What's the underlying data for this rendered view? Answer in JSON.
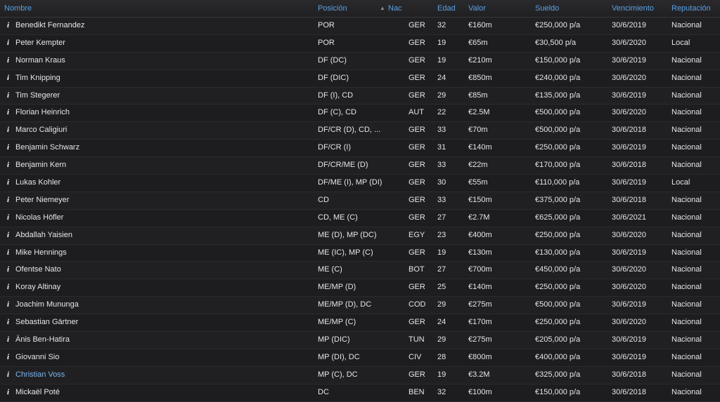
{
  "headers": {
    "name": "Nombre",
    "position": "Posición",
    "nationality": "Nac",
    "age": "Edad",
    "value": "Valor",
    "salary": "Sueldo",
    "expiry": "Vencimiento",
    "reputation": "Reputación"
  },
  "info_glyph": "i",
  "colors": {
    "header_text": "#5aa0e6",
    "link_text": "#7fb3ea",
    "background": "#1b1b1d"
  },
  "rows": [
    {
      "name": "Benedikt Fernandez",
      "position": "POR",
      "flag": "ger-flag-icon",
      "nat": "GER",
      "age": "32",
      "value": "€160m",
      "salary": "€250,000 p/a",
      "expiry": "30/6/2019",
      "reputation": "Nacional"
    },
    {
      "name": "Peter Kempter",
      "position": "POR",
      "flag": "ger-flag-icon",
      "nat": "GER",
      "age": "19",
      "value": "€65m",
      "salary": "€30,500 p/a",
      "expiry": "30/6/2020",
      "reputation": "Local"
    },
    {
      "name": "Norman Kraus",
      "position": "DF (DC)",
      "flag": "ger-flag-icon",
      "nat": "GER",
      "age": "19",
      "value": "€210m",
      "salary": "€150,000 p/a",
      "expiry": "30/6/2019",
      "reputation": "Nacional"
    },
    {
      "name": "Tim Knipping",
      "position": "DF (DIC)",
      "flag": "ger-flag-icon",
      "nat": "GER",
      "age": "24",
      "value": "€850m",
      "salary": "€240,000 p/a",
      "expiry": "30/6/2020",
      "reputation": "Nacional"
    },
    {
      "name": "Tim Stegerer",
      "position": "DF (I), CD",
      "flag": "ger-flag-icon",
      "nat": "GER",
      "age": "29",
      "value": "€85m",
      "salary": "€135,000 p/a",
      "expiry": "30/6/2019",
      "reputation": "Nacional"
    },
    {
      "name": "Florian Heinrich",
      "position": "DF (C), CD",
      "flag": "aut-flag-icon",
      "nat": "AUT",
      "age": "22",
      "value": "€2.5M",
      "salary": "€500,000 p/a",
      "expiry": "30/6/2020",
      "reputation": "Nacional"
    },
    {
      "name": "Marco Caligiuri",
      "position": "DF/CR (D), CD, ...",
      "flag": "ger-flag-icon",
      "nat": "GER",
      "age": "33",
      "value": "€70m",
      "salary": "€500,000 p/a",
      "expiry": "30/6/2018",
      "reputation": "Nacional"
    },
    {
      "name": "Benjamin Schwarz",
      "position": "DF/CR (I)",
      "flag": "ger-flag-icon",
      "nat": "GER",
      "age": "31",
      "value": "€140m",
      "salary": "€250,000 p/a",
      "expiry": "30/6/2019",
      "reputation": "Nacional"
    },
    {
      "name": "Benjamin Kern",
      "position": "DF/CR/ME (D)",
      "flag": "ger-flag-icon",
      "nat": "GER",
      "age": "33",
      "value": "€22m",
      "salary": "€170,000 p/a",
      "expiry": "30/6/2018",
      "reputation": "Nacional"
    },
    {
      "name": "Lukas Kohler",
      "position": "DF/ME (I), MP (DI)",
      "flag": "ger-flag-icon",
      "nat": "GER",
      "age": "30",
      "value": "€55m",
      "salary": "€110,000 p/a",
      "expiry": "30/6/2019",
      "reputation": "Local"
    },
    {
      "name": "Peter Niemeyer",
      "position": "CD",
      "flag": "ger-flag-icon",
      "nat": "GER",
      "age": "33",
      "value": "€150m",
      "salary": "€375,000 p/a",
      "expiry": "30/6/2018",
      "reputation": "Nacional"
    },
    {
      "name": "Nicolas Höfler",
      "position": "CD, ME (C)",
      "flag": "ger-flag-icon",
      "nat": "GER",
      "age": "27",
      "value": "€2.7M",
      "salary": "€625,000 p/a",
      "expiry": "30/6/2021",
      "reputation": "Nacional"
    },
    {
      "name": "Abdallah Yaisien",
      "position": "ME (D), MP (DC)",
      "flag": "egy-flag-icon",
      "nat": "EGY",
      "age": "23",
      "value": "€400m",
      "salary": "€250,000 p/a",
      "expiry": "30/6/2020",
      "reputation": "Nacional"
    },
    {
      "name": "Mike Hennings",
      "position": "ME (IC), MP (C)",
      "flag": "ger-flag-icon",
      "nat": "GER",
      "age": "19",
      "value": "€130m",
      "salary": "€130,000 p/a",
      "expiry": "30/6/2019",
      "reputation": "Nacional"
    },
    {
      "name": "Ofentse Nato",
      "position": "ME (C)",
      "flag": "bot-flag-icon",
      "nat": "BOT",
      "age": "27",
      "value": "€700m",
      "salary": "€450,000 p/a",
      "expiry": "30/6/2020",
      "reputation": "Nacional"
    },
    {
      "name": "Koray Altinay",
      "position": "ME/MP (D)",
      "flag": "ger-flag-icon",
      "nat": "GER",
      "age": "25",
      "value": "€140m",
      "salary": "€250,000 p/a",
      "expiry": "30/6/2020",
      "reputation": "Nacional"
    },
    {
      "name": "Joachim Mununga",
      "position": "ME/MP (D), DC",
      "flag": "cod-flag-icon",
      "nat": "COD",
      "age": "29",
      "value": "€275m",
      "salary": "€500,000 p/a",
      "expiry": "30/6/2019",
      "reputation": "Nacional"
    },
    {
      "name": "Sebastian Gärtner",
      "position": "ME/MP (C)",
      "flag": "ger-flag-icon",
      "nat": "GER",
      "age": "24",
      "value": "€170m",
      "salary": "€250,000 p/a",
      "expiry": "30/6/2020",
      "reputation": "Nacional"
    },
    {
      "name": "Änis Ben-Hatira",
      "position": "MP (DIC)",
      "flag": "tun-flag-icon",
      "nat": "TUN",
      "age": "29",
      "value": "€275m",
      "salary": "€205,000 p/a",
      "expiry": "30/6/2019",
      "reputation": "Nacional"
    },
    {
      "name": "Giovanni Sio",
      "position": "MP (DI), DC",
      "flag": "civ-flag-icon",
      "nat": "CIV",
      "age": "28",
      "value": "€800m",
      "salary": "€400,000 p/a",
      "expiry": "30/6/2019",
      "reputation": "Nacional"
    },
    {
      "name": "Christian Voss",
      "position": "MP (C), DC",
      "flag": "ger-flag-icon",
      "nat": "GER",
      "age": "19",
      "value": "€3.2M",
      "salary": "€325,000 p/a",
      "expiry": "30/6/2018",
      "reputation": "Nacional",
      "link": true
    },
    {
      "name": "Mickaël Poté",
      "position": "DC",
      "flag": "ben-flag-icon",
      "nat": "BEN",
      "age": "32",
      "value": "€100m",
      "salary": "€150,000 p/a",
      "expiry": "30/6/2018",
      "reputation": "Nacional"
    }
  ]
}
